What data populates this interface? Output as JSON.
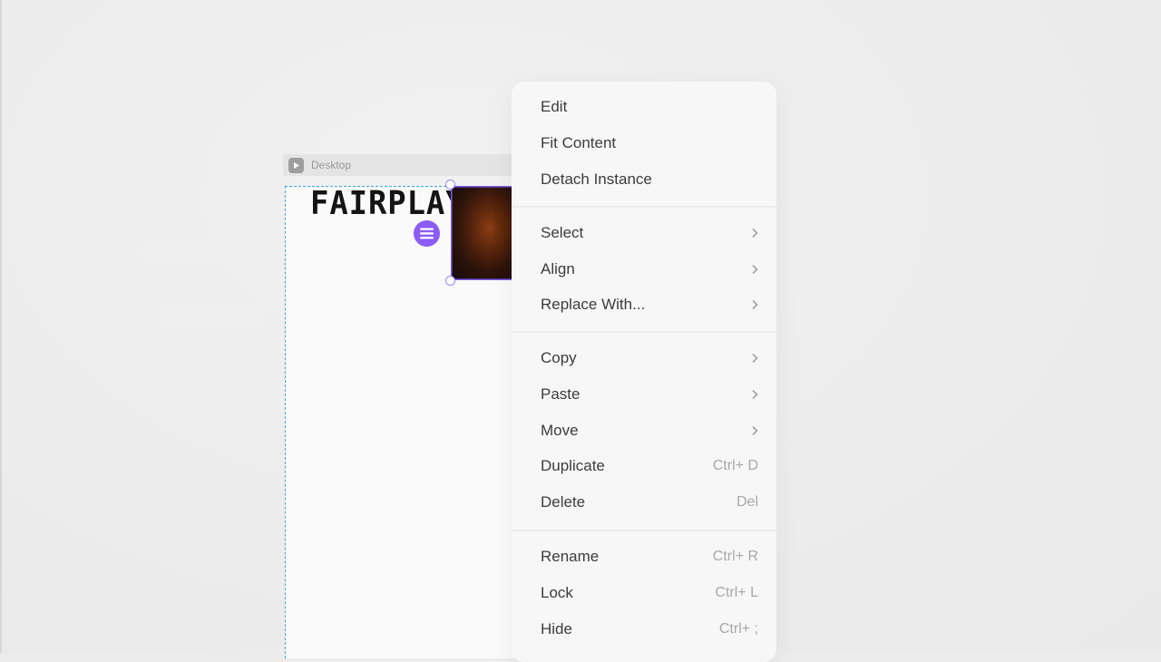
{
  "frame": {
    "label": "Desktop",
    "logo_text": "FAIRPLAY"
  },
  "context_menu": {
    "group1": [
      {
        "label": "Edit"
      },
      {
        "label": "Fit Content"
      },
      {
        "label": "Detach Instance"
      }
    ],
    "group2": [
      {
        "label": "Select",
        "submenu": true
      },
      {
        "label": "Align",
        "submenu": true
      },
      {
        "label": "Replace With...",
        "submenu": true
      }
    ],
    "group3": [
      {
        "label": "Copy",
        "submenu": true
      },
      {
        "label": "Paste",
        "submenu": true
      },
      {
        "label": "Move",
        "submenu": true
      },
      {
        "label": "Duplicate",
        "shortcut": "Ctrl+ D"
      },
      {
        "label": "Delete",
        "shortcut": "Del"
      }
    ],
    "group4": [
      {
        "label": "Rename",
        "shortcut": "Ctrl+ R"
      },
      {
        "label": "Lock",
        "shortcut": "Ctrl+ L"
      },
      {
        "label": "Hide",
        "shortcut": "Ctrl+ ;"
      }
    ]
  },
  "colors": {
    "accent": "#8b5cf6",
    "selection": "#3ba3e8"
  }
}
